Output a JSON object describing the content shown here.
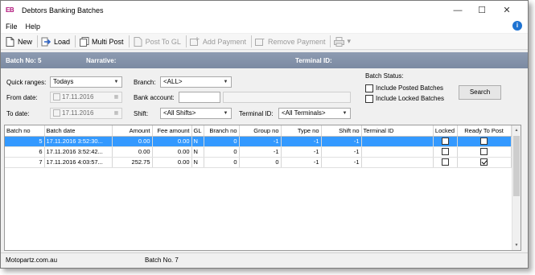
{
  "window": {
    "logo": "EB",
    "title": "Debtors Banking Batches",
    "minimize_glyph": "—",
    "maximize_glyph": "☐",
    "close_glyph": "✕"
  },
  "menu": {
    "file": "File",
    "help": "Help",
    "info_glyph": "i"
  },
  "toolbar": {
    "new": "New",
    "load": "Load",
    "multi_post": "Multi Post",
    "post_to_gl": "Post To GL",
    "add_payment": "Add Payment",
    "remove_payment": "Remove Payment",
    "dropdown_glyph": "▾"
  },
  "info_band": {
    "batch_no": "Batch No: 5",
    "narrative": "Narrative:",
    "terminal_id": "Terminal ID:"
  },
  "filters": {
    "quick_ranges_label": "Quick ranges:",
    "quick_ranges_value": "Todays",
    "from_date_label": "From date:",
    "from_date_value": "17.11.2016",
    "to_date_label": "To date:",
    "to_date_value": "17.11.2016",
    "branch_label": "Branch:",
    "branch_value": "<ALL>",
    "bank_account_label": "Bank account:",
    "bank_account_value": "",
    "shift_label": "Shift:",
    "shift_value": "<All Shifts>",
    "terminal_id_label": "Terminal ID:",
    "terminal_id_value": "<All Terminals>",
    "batch_status_label": "Batch Status:",
    "include_posted": "Include Posted Batches",
    "include_locked": "Include Locked Batches",
    "search_button": "Search",
    "dropdown_glyph": "▼",
    "calendar_glyph": "▦"
  },
  "grid": {
    "columns": [
      "Batch no",
      "Batch date",
      "Amount",
      "Fee amount",
      "GL",
      "Branch no",
      "Group no",
      "Type no",
      "Shift no",
      "Terminal ID",
      "Locked",
      "Ready To Post"
    ],
    "rows": [
      {
        "batch_no": "5",
        "batch_date": "17.11.2016 3:52:30...",
        "amount": "0.00",
        "fee_amount": "0.00",
        "gl": "N",
        "branch_no": "0",
        "group_no": "-1",
        "type_no": "-1",
        "shift_no": "-1",
        "terminal_id": "",
        "locked": false,
        "ready_to_post": false
      },
      {
        "batch_no": "6",
        "batch_date": "17.11.2016 3:52:42...",
        "amount": "0.00",
        "fee_amount": "0.00",
        "gl": "N",
        "branch_no": "0",
        "group_no": "-1",
        "type_no": "-1",
        "shift_no": "-1",
        "terminal_id": "",
        "locked": false,
        "ready_to_post": false
      },
      {
        "batch_no": "7",
        "batch_date": "17.11.2016 4:03:57...",
        "amount": "252.75",
        "fee_amount": "0.00",
        "gl": "N",
        "branch_no": "0",
        "group_no": "0",
        "type_no": "-1",
        "shift_no": "-1",
        "terminal_id": "",
        "locked": false,
        "ready_to_post": true
      }
    ],
    "scroll_up_glyph": "▲",
    "scroll_down_glyph": "▼"
  },
  "status": {
    "site": "Motopartz.com.au",
    "batch": "Batch No. 7"
  },
  "colors": {
    "selection": "#3399ff",
    "info_band": "#8393ab",
    "logo": "#b0127a"
  }
}
